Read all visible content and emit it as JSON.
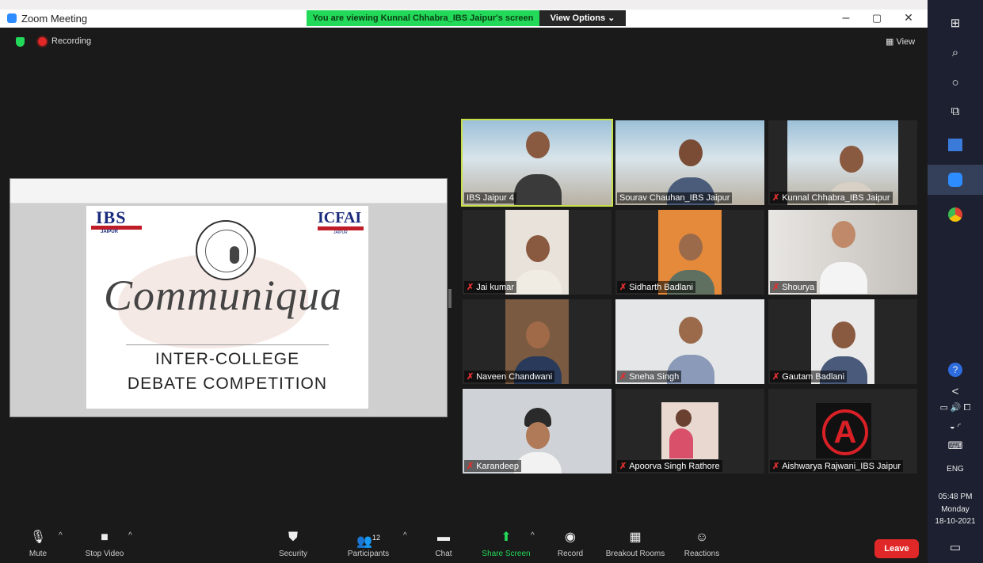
{
  "window": {
    "title": "Zoom Meeting",
    "minimize": "–",
    "maximize": "▢",
    "close": "✕"
  },
  "banner": {
    "text": "You are viewing Kunnal Chhabra_IBS Jaipur's screen",
    "view_options": "View Options ⌄"
  },
  "meeting": {
    "recording": "Recording",
    "view": "View",
    "view_icon": "▦"
  },
  "slide": {
    "ibs": "IBS",
    "ibs_city": "JAIPUR",
    "icfai": "ICFAI",
    "icfai_city": "JAIPUR",
    "script_title": "Communiqua",
    "line1": "INTER-COLLEGE",
    "line2": "DEBATE COMPETITION"
  },
  "participants": [
    {
      "name": "IBS Jaipur 4",
      "muted": false,
      "active": true
    },
    {
      "name": "Sourav Chauhan_IBS Jaipur",
      "muted": false
    },
    {
      "name": "Kunnal Chhabra_IBS Jaipur",
      "muted": true
    },
    {
      "name": "Jai kumar",
      "muted": true
    },
    {
      "name": "Sidharth Badlani",
      "muted": true
    },
    {
      "name": "Shourya",
      "muted": true
    },
    {
      "name": "Naveen Chandwani",
      "muted": true
    },
    {
      "name": "Sneha Singh",
      "muted": true
    },
    {
      "name": "Gautam Badlani",
      "muted": true
    },
    {
      "name": "Karandeep",
      "muted": true
    },
    {
      "name": "Apoorva Singh Rathore",
      "muted": true
    },
    {
      "name": "Aishwarya Rajwani_IBS Jaipur",
      "muted": true
    }
  ],
  "toolbar": {
    "mute": "Mute",
    "stop_video": "Stop Video",
    "security": "Security",
    "participants": "Participants",
    "participants_count": "12",
    "chat": "Chat",
    "share_screen": "Share Screen",
    "record": "Record",
    "breakout_rooms": "Breakout Rooms",
    "reactions": "Reactions",
    "leave": "Leave",
    "caret": "^"
  },
  "taskbar": {
    "lang": "ENG",
    "time": "05:48 PM",
    "day": "Monday",
    "date": "18-10-2021",
    "chevron": "<"
  },
  "colors": {
    "accent_green": "#23d959",
    "leave_red": "#e02828",
    "active_border": "#c8e04a"
  }
}
